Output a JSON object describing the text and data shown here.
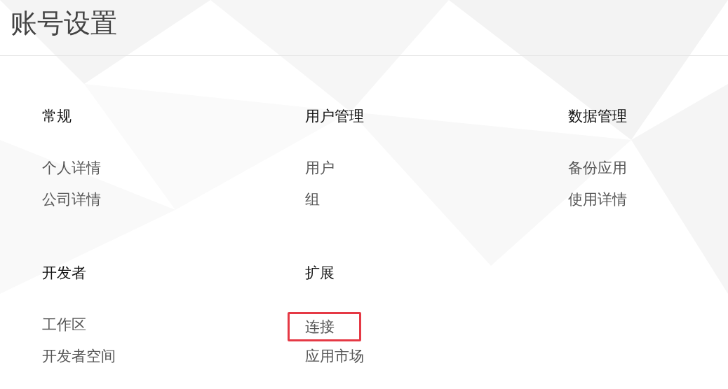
{
  "page": {
    "title": "账号设置"
  },
  "sections": [
    {
      "heading": "常规",
      "items": [
        {
          "label": "个人详情",
          "highlighted": false
        },
        {
          "label": "公司详情",
          "highlighted": false
        }
      ]
    },
    {
      "heading": "用户管理",
      "items": [
        {
          "label": "用户",
          "highlighted": false
        },
        {
          "label": "组",
          "highlighted": false
        }
      ]
    },
    {
      "heading": "数据管理",
      "items": [
        {
          "label": "备份应用",
          "highlighted": false
        },
        {
          "label": "使用详情",
          "highlighted": false
        }
      ]
    },
    {
      "heading": "开发者",
      "items": [
        {
          "label": "工作区",
          "highlighted": false
        },
        {
          "label": "开发者空间",
          "highlighted": false
        }
      ]
    },
    {
      "heading": "扩展",
      "items": [
        {
          "label": "连接",
          "highlighted": true
        },
        {
          "label": "应用市场",
          "highlighted": false
        }
      ]
    }
  ]
}
